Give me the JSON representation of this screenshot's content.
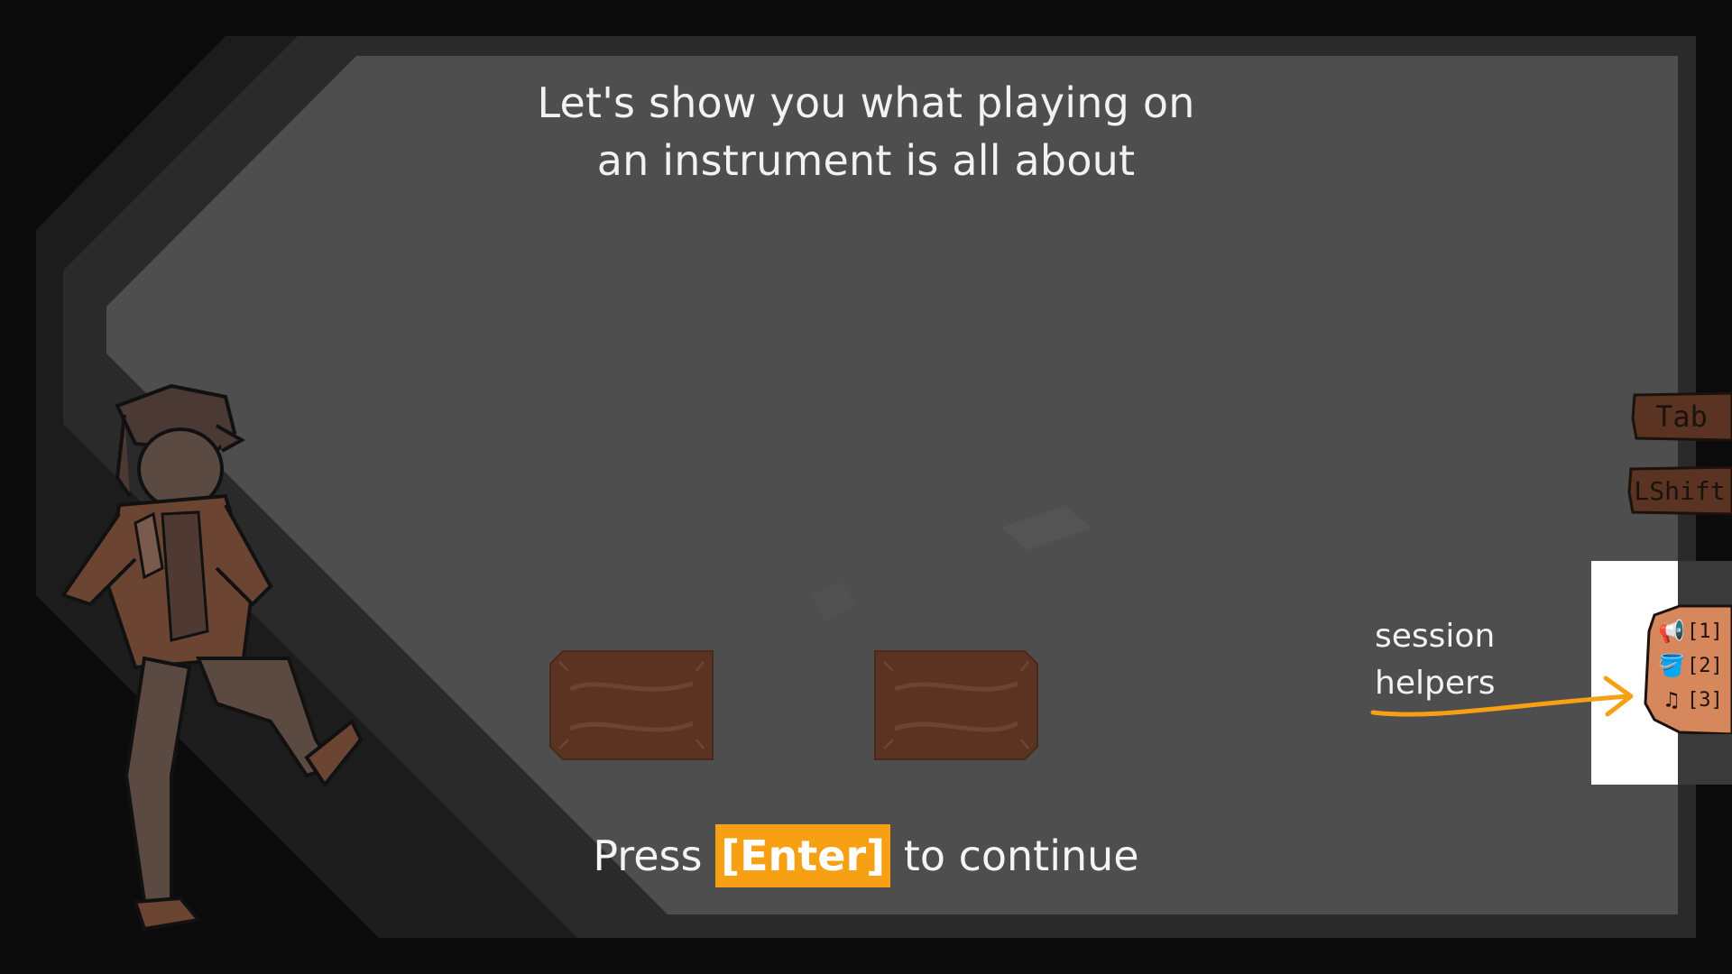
{
  "tutorial": {
    "instruction_line1": "Let's show you what playing on",
    "instruction_line2": "an instrument is all about",
    "continue_prefix": "Press ",
    "continue_key": "[Enter]",
    "continue_suffix": " to continue"
  },
  "keys": {
    "tab": "Tab",
    "lshift": "LShift"
  },
  "session_helpers": {
    "label_line1": "session",
    "label_line2": "helpers",
    "items": [
      {
        "icon": "megaphone-icon",
        "key": "[1]"
      },
      {
        "icon": "bucket-icon",
        "key": "[2]"
      },
      {
        "icon": "music-notes-icon",
        "key": "[3]"
      }
    ]
  },
  "colors": {
    "highlight": "#f7a013",
    "panel_gray": "#4e4e4e",
    "wood": "#5a3322"
  }
}
